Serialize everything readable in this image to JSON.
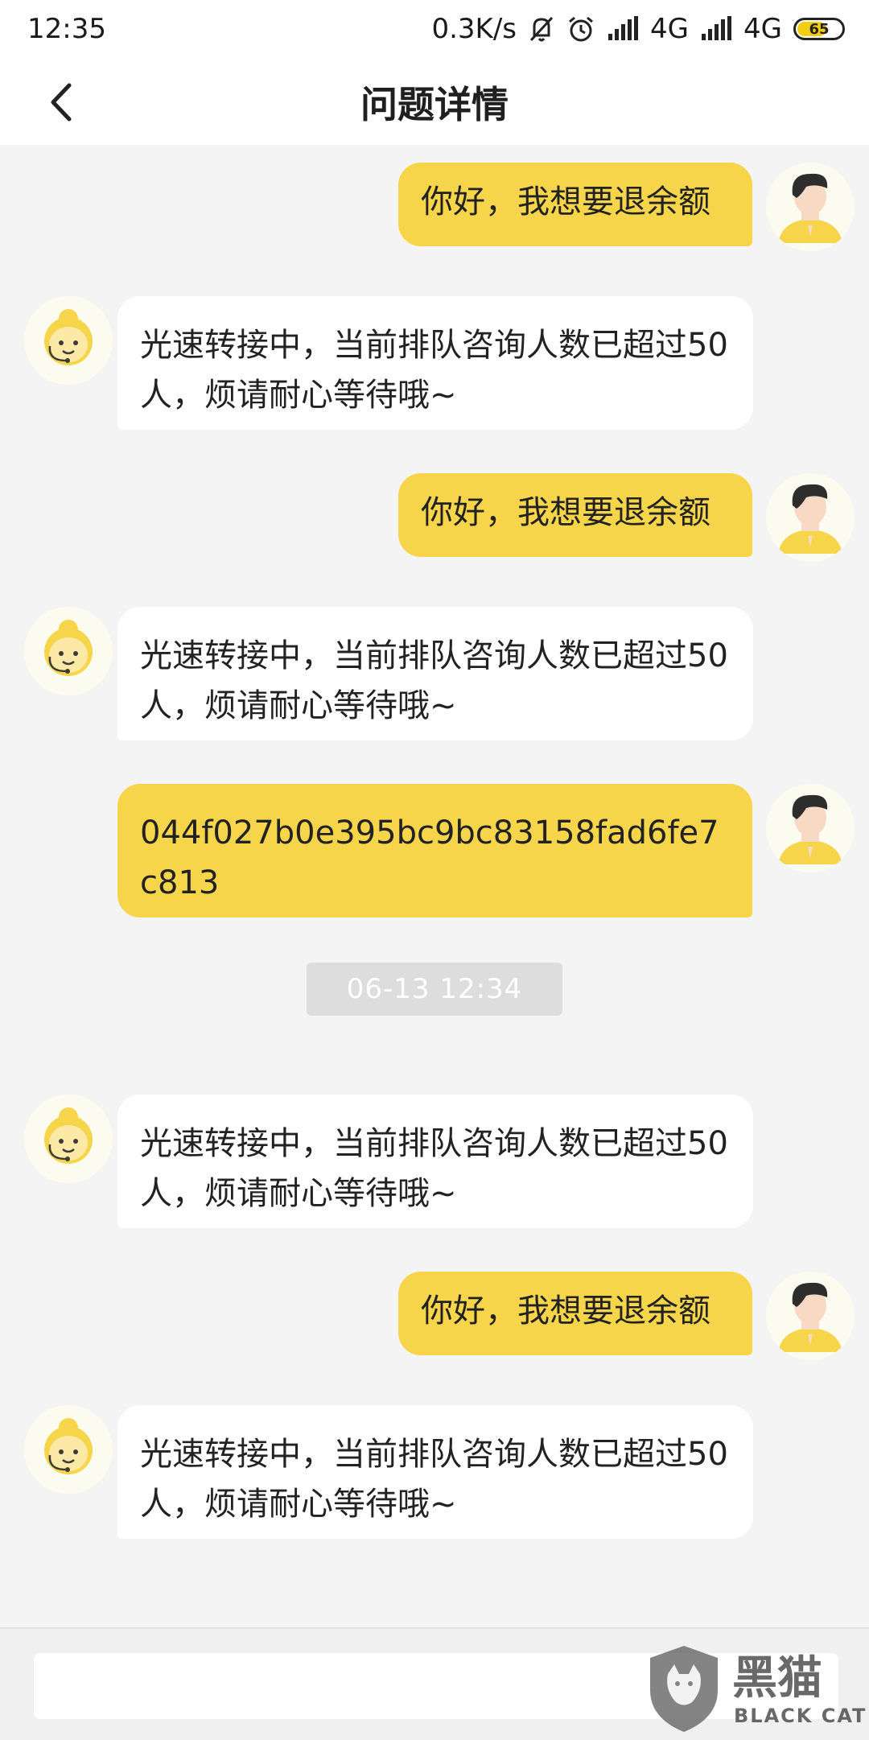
{
  "status_bar": {
    "time": "12:35",
    "speed": "0.3K/s",
    "net1": "4G",
    "net2": "4G",
    "battery": "65"
  },
  "header": {
    "title": "问题详情"
  },
  "messages": [
    {
      "sender": "user",
      "text": "你好，我想要退余额"
    },
    {
      "sender": "agent",
      "text": "光速转接中，当前排队咨询人数已超过50人，烦请耐心等待哦~"
    },
    {
      "sender": "user",
      "text": "你好，我想要退余额"
    },
    {
      "sender": "agent",
      "text": "光速转接中，当前排队咨询人数已超过50人，烦请耐心等待哦~"
    },
    {
      "sender": "user",
      "text": "044f027b0e395bc9bc83158fad6fe7c813"
    },
    {
      "sender": "agent",
      "text": "光速转接中，当前排队咨询人数已超过50人，烦请耐心等待哦~"
    },
    {
      "sender": "user",
      "text": "你好，我想要退余额"
    },
    {
      "sender": "agent",
      "text": "光速转接中，当前排队咨询人数已超过50人，烦请耐心等待哦~"
    }
  ],
  "timestamp_divider": "06-13 12:34",
  "input": {
    "placeholder": ""
  },
  "watermark": {
    "cn": "黑猫",
    "en": "BLACK CAT"
  },
  "colors": {
    "user_bubble": "#f6d54a",
    "agent_bubble": "#ffffff",
    "background": "#f4f4f4"
  }
}
